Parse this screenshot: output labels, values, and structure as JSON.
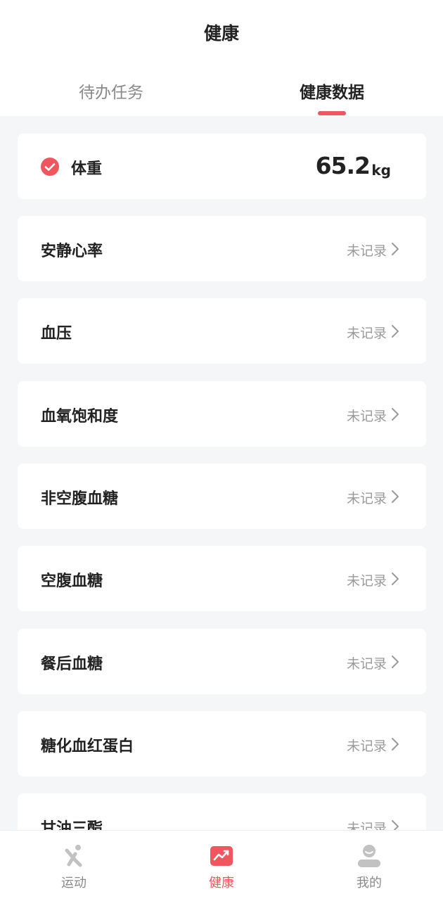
{
  "header": {
    "title": "健康",
    "tabs": [
      {
        "label": "待办任务",
        "active": false
      },
      {
        "label": "健康数据",
        "active": true
      }
    ]
  },
  "weight": {
    "label": "体重",
    "value": "65.2",
    "unit": "kg",
    "checked": true
  },
  "metrics": [
    {
      "label": "安静心率",
      "status": "未记录"
    },
    {
      "label": "血压",
      "status": "未记录"
    },
    {
      "label": "血氧饱和度",
      "status": "未记录"
    },
    {
      "label": "非空腹血糖",
      "status": "未记录"
    },
    {
      "label": "空腹血糖",
      "status": "未记录"
    },
    {
      "label": "餐后血糖",
      "status": "未记录"
    },
    {
      "label": "糖化血红蛋白",
      "status": "未记录"
    },
    {
      "label": "甘油三酯",
      "status": "未记录"
    }
  ],
  "bottom_nav": {
    "items": [
      {
        "label": "运动",
        "icon": "running-icon",
        "active": false
      },
      {
        "label": "健康",
        "icon": "trend-chart-icon",
        "active": true
      },
      {
        "label": "我的",
        "icon": "user-icon",
        "active": false
      }
    ]
  },
  "colors": {
    "accent": "#f0565e",
    "background": "#f5f6f8",
    "card": "#ffffff",
    "muted_text": "#9a9a9a"
  }
}
